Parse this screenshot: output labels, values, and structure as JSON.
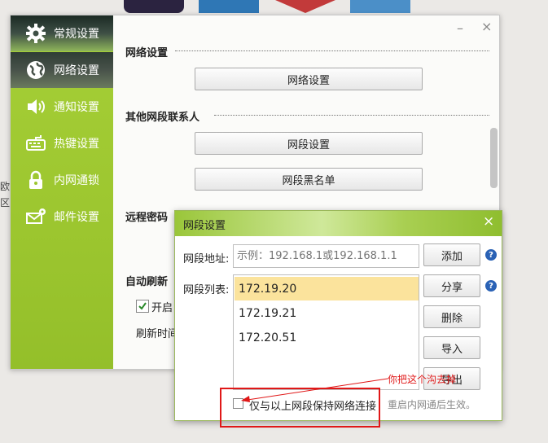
{
  "sidebar": {
    "items": [
      {
        "label": "常规设置",
        "icon": "gear-icon"
      },
      {
        "label": "网络设置",
        "icon": "globe-icon"
      },
      {
        "label": "通知设置",
        "icon": "speaker-icon"
      },
      {
        "label": "热键设置",
        "icon": "keyboard-icon"
      },
      {
        "label": "内网通锁",
        "icon": "lock-icon"
      },
      {
        "label": "邮件设置",
        "icon": "mail-gear-icon"
      }
    ],
    "selected_index": 1
  },
  "content": {
    "network_section": "网络设置",
    "network_button": "网络设置",
    "other_section": "其他网段联系人",
    "segment_button": "网段设置",
    "blacklist_button": "网段黑名单",
    "remote_password_section": "远程密码",
    "auto_refresh_section": "自动刷新",
    "auto_refresh_checkbox": "开启",
    "refresh_time_label": "刷新时间",
    "minimize": "–",
    "close": "×"
  },
  "background": {
    "text1": "欧",
    "text2": "区"
  },
  "dialog": {
    "title": "网段设置",
    "close": "×",
    "address_label": "网段地址:",
    "address_placeholder": "示例：192.168.1或192.168.1.1",
    "list_label": "网段列表:",
    "list_items": [
      "172.19.20",
      "172.19.21",
      "172.20.51"
    ],
    "selected_index": 0,
    "buttons": {
      "add": "添加",
      "share": "分享",
      "delete": "删除",
      "import": "导入",
      "export": "导出"
    },
    "help": "?",
    "keep_connection_label": "仅与以上网段保持网络连接",
    "keep_connection_checked": false,
    "restart_note": "重启内网通后生效。"
  },
  "annotation": {
    "text": "你把这个沟去掉",
    "color": "#e01818"
  }
}
